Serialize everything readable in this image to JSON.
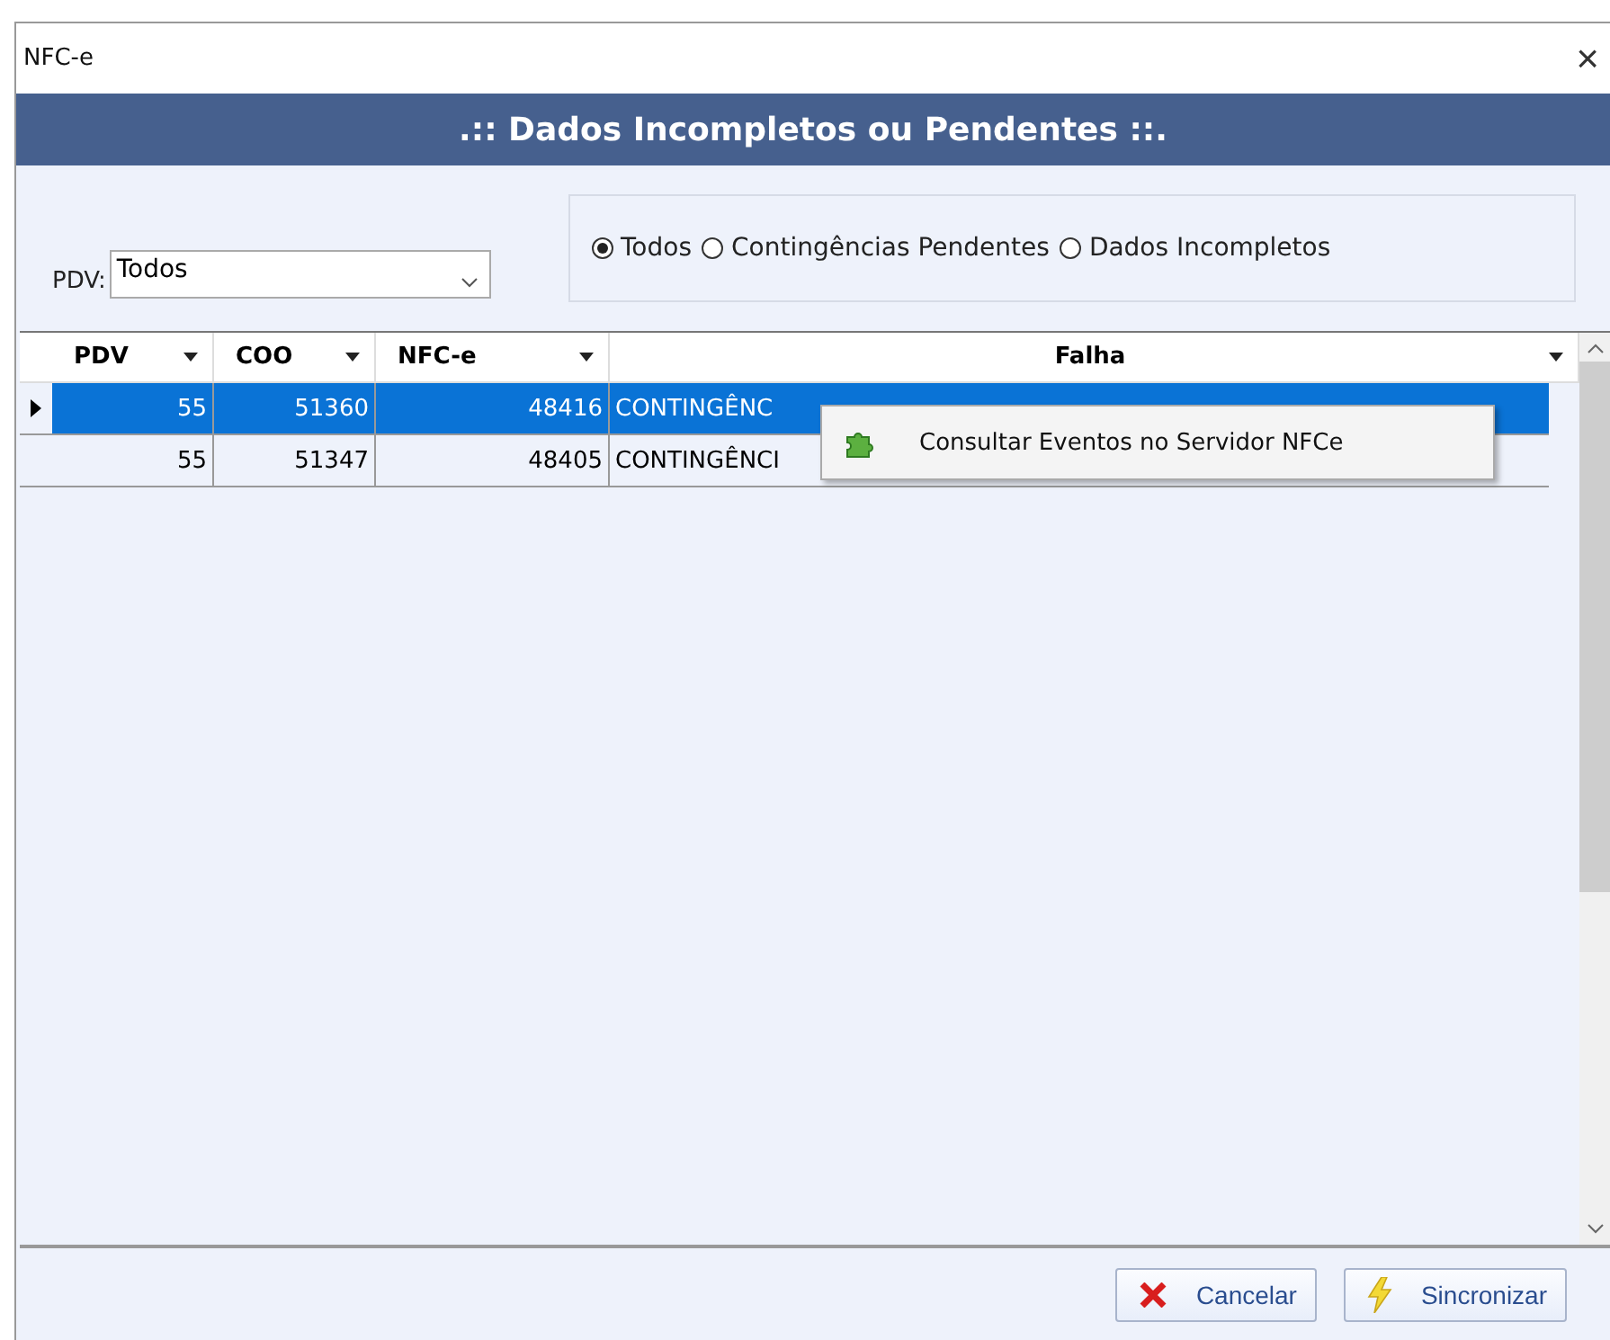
{
  "window": {
    "title": "NFC-e",
    "close": "×"
  },
  "header": {
    "title": ".:: Dados Incompletos ou Pendentes ::."
  },
  "filter": {
    "label": "PDV:",
    "value": "Todos"
  },
  "radios": [
    {
      "label": "Todos",
      "selected": true
    },
    {
      "label": "Contingências Pendentes",
      "selected": false
    },
    {
      "label": "Dados Incompletos",
      "selected": false
    }
  ],
  "table": {
    "columns": [
      "PDV",
      "COO",
      "NFC-e",
      "Falha"
    ],
    "rows": [
      {
        "selected": true,
        "cells": [
          "55",
          "51360",
          "48416",
          "CONTINGÊNC"
        ]
      },
      {
        "selected": false,
        "cells": [
          "55",
          "51347",
          "48405",
          "CONTINGÊNCI"
        ]
      }
    ]
  },
  "context_menu": {
    "items": [
      "Consultar Eventos no Servidor NFCe"
    ]
  },
  "buttons": [
    {
      "kind": "cancel",
      "label": "Cancelar"
    },
    {
      "kind": "sync",
      "label": "Sincronizar"
    }
  ]
}
